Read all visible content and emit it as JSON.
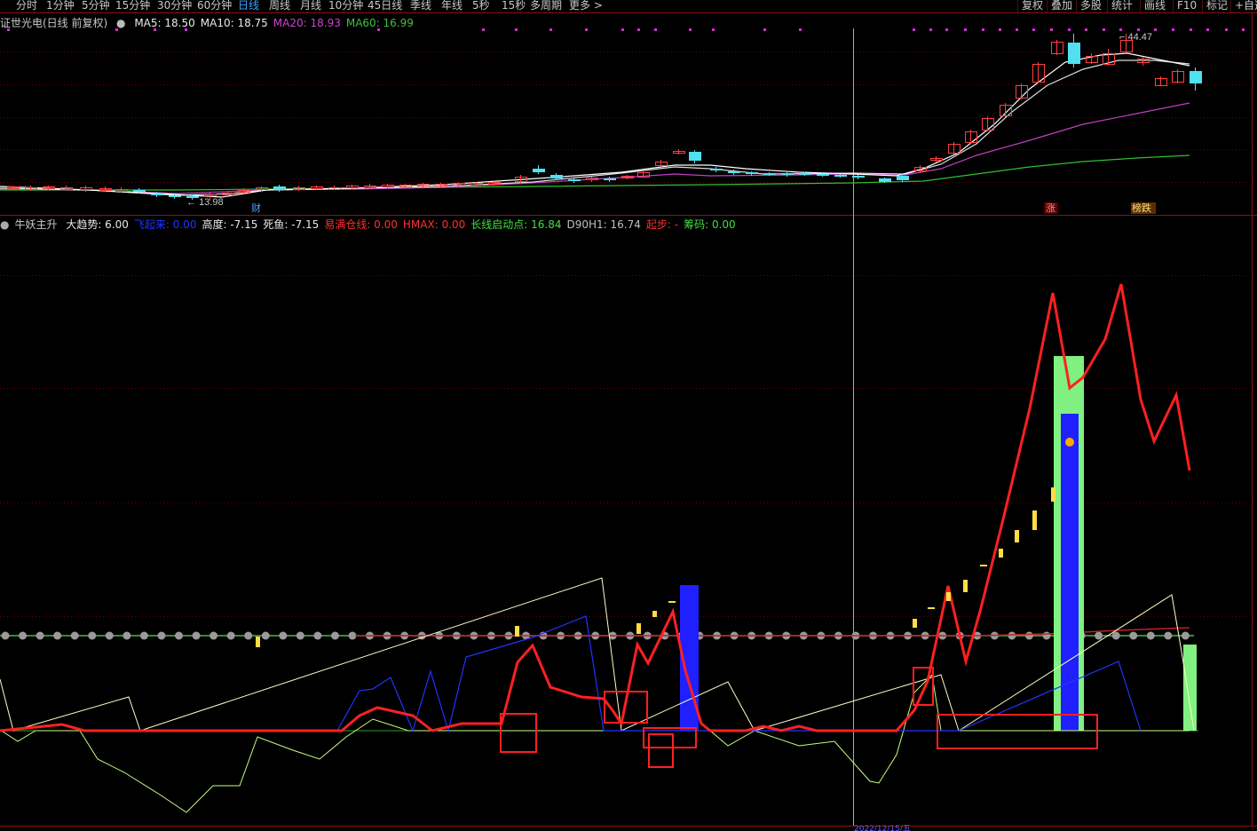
{
  "toolbar": {
    "periods": [
      "分时",
      "1分钟",
      "5分钟",
      "15分钟",
      "30分钟",
      "60分钟",
      "日线",
      "周线",
      "月线",
      "10分钟",
      "45日线",
      "季线",
      "年线",
      "5秒",
      "15秒",
      "多周期",
      "更多 >"
    ],
    "active_period": "日线",
    "right_buttons": [
      "复权",
      "叠加",
      "多股",
      "统计",
      "画线",
      "F10",
      "标记",
      "+自选"
    ]
  },
  "main_panel": {
    "stock_title": "证世光电(日线 前复权)",
    "ma_labels": [
      {
        "text": "MA5: 18.50",
        "color": "#e8e8e8"
      },
      {
        "text": "MA10: 18.75",
        "color": "#e8e8e8"
      },
      {
        "text": "MA20: 18.93",
        "color": "#d040d0"
      },
      {
        "text": "MA60: 16.99",
        "color": "#40c040"
      }
    ],
    "high_label": "44.47",
    "low_label": "13.98",
    "markers": {
      "cai": "财",
      "zhang": "涨",
      "bangdie": "榜跌"
    }
  },
  "sub_panel": {
    "indicator_name": "牛妖主升",
    "legend": [
      {
        "text": "大趋势: 6.00",
        "color": "#e8e8e8"
      },
      {
        "text": "飞起来: 0.00",
        "color": "#2233ff"
      },
      {
        "text": "高度: -7.15",
        "color": "#e8e8e8"
      },
      {
        "text": "死鱼: -7.15",
        "color": "#e8e8e8"
      },
      {
        "text": "易满仓线: 0.00",
        "color": "#ff3030"
      },
      {
        "text": "HMAX: 0.00",
        "color": "#ff3030"
      },
      {
        "text": "长线启动点: 16.84",
        "color": "#40e040"
      },
      {
        "text": "D90H1: 16.74",
        "color": "#c0c0c0"
      },
      {
        "text": "起步: -",
        "color": "#ff3030"
      },
      {
        "text": "筹码: 0.00",
        "color": "#40e040"
      }
    ]
  },
  "colors": {
    "up": "#ff4040",
    "down": "#50e0f0",
    "grid": "#6a0000",
    "red_line": "#ff2020",
    "blue": "#2020ff",
    "green": "#80ff80",
    "yellow": "#ffdd44"
  }
}
